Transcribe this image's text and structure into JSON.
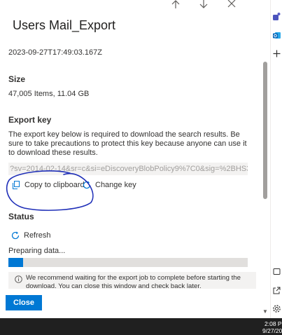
{
  "panel": {
    "title": "Users Mail_Export",
    "timestamp": "2023-09-27T17:49:03.167Z",
    "size": {
      "heading": "Size",
      "value": "47,005 Items, 11.04 GB"
    },
    "export_key": {
      "heading": "Export key",
      "description": "The export key below is required to download the search results. Be sure to take precautions to protect this key because anyone can use it to download these results.",
      "key_value": "?sv=2014-02-14&sr=c&si=eDiscoveryBlobPolicy9%7C0&sig=%2BHS3Hhi0nzp...",
      "copy_label": "Copy to clipboard",
      "change_label": "Change key"
    },
    "status": {
      "heading": "Status",
      "refresh_label": "Refresh",
      "state_text": "Preparing data...",
      "progress": 0.06
    },
    "info_message": "We recommend waiting for the export job to complete before starting the download. You can close this window and check back later.",
    "close_label": "Close"
  },
  "taskbar": {
    "time": "2:08 P",
    "date": "9/27/20"
  },
  "icons": {
    "up": "arrow-up-icon",
    "down": "arrow-down-icon",
    "close": "close-icon",
    "copy": "copy-icon",
    "change": "refresh-circle-icon",
    "refresh": "refresh-icon",
    "info": "info-icon"
  },
  "colors": {
    "accent": "#0078d4",
    "annotation": "#1f2fb8"
  }
}
